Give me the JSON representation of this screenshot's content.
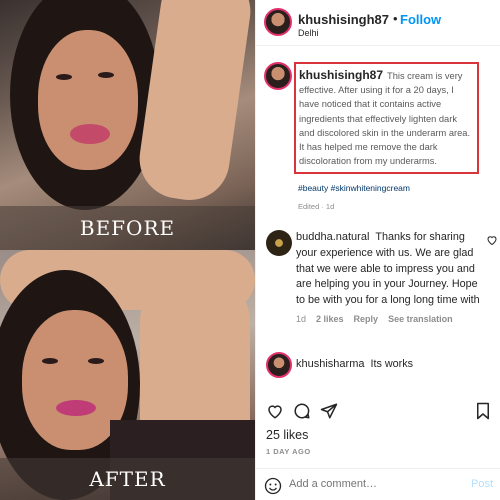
{
  "photos": {
    "before_label": "BEFORE",
    "after_label": "AFTER"
  },
  "header": {
    "username": "khushisingh87",
    "separator": "•",
    "follow_label": "Follow",
    "location": "Delhi"
  },
  "caption": {
    "username": "khushisingh87",
    "text": "This cream is very effective. After using it for a 20 days, I have noticed that it contains active ingredients that effectively lighten dark and discolored skin in the underarm area. It has helped me remove the dark discoloration from my underarms.",
    "hashtags": "#beauty #skinwhiteningcream",
    "edited": "Edited · 1d"
  },
  "comments": [
    {
      "username": "buddha.natural",
      "text": "Thanks for sharing your experience with us. We are glad that we were able to impress you and are helping you in your Journey. Hope to be with you for a long long time with",
      "time": "1d",
      "likes": "2 likes",
      "reply": "Reply",
      "translate": "See translation"
    },
    {
      "username": "khushisharma",
      "text": "Its works"
    }
  ],
  "footer": {
    "likes": "25 likes",
    "date": "1 DAY AGO",
    "comment_placeholder": "Add a comment…",
    "post_label": "Post"
  },
  "colors": {
    "follow": "#0095f6",
    "highlight_border": "#d9343b",
    "hashtag": "#00376b"
  },
  "icons": [
    "heart-icon",
    "comment-icon",
    "share-icon",
    "bookmark-icon",
    "emoji-icon"
  ]
}
